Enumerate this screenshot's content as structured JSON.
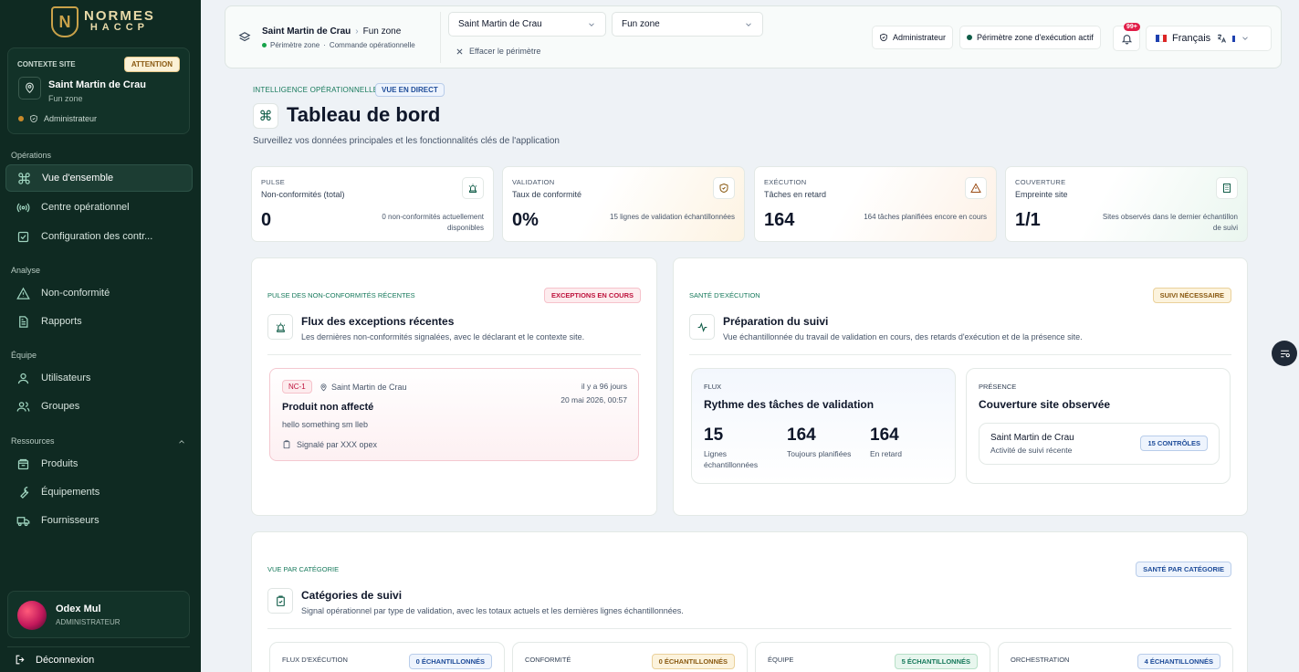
{
  "brand": {
    "line1": "NORMES",
    "line2": "HACCP",
    "mark": "N"
  },
  "site_context": {
    "label": "CONTEXTE SITE",
    "badge": "ATTENTION",
    "site": "Saint Martin de Crau",
    "zone": "Fun zone",
    "role": "Administrateur"
  },
  "sidebar": {
    "sections": [
      {
        "title": "Opérations",
        "items": [
          {
            "label": "Vue d'ensemble",
            "icon": "command-icon",
            "active": true
          },
          {
            "label": "Centre opérationnel",
            "icon": "broadcast-icon"
          },
          {
            "label": "Configuration des contr...",
            "icon": "checkbox-icon"
          }
        ]
      },
      {
        "title": "Analyse",
        "items": [
          {
            "label": "Non-conformité",
            "icon": "warning-triangle-icon"
          },
          {
            "label": "Rapports",
            "icon": "document-icon"
          }
        ]
      },
      {
        "title": "Équipe",
        "items": [
          {
            "label": "Utilisateurs",
            "icon": "user-icon"
          },
          {
            "label": "Groupes",
            "icon": "users-icon"
          }
        ]
      },
      {
        "title": "Ressources",
        "items": [
          {
            "label": "Produits",
            "icon": "package-icon"
          },
          {
            "label": "Équipements",
            "icon": "wrench-icon"
          },
          {
            "label": "Fournisseurs",
            "icon": "truck-icon"
          }
        ]
      }
    ],
    "user": {
      "name": "Odex Mul",
      "role": "ADMINISTRATEUR"
    },
    "logout": "Déconnexion"
  },
  "topbar": {
    "breadcrumb_site": "Saint Martin de Crau",
    "breadcrumb_zone": "Fun zone",
    "scope": "Périmètre zone",
    "scope_mode": "Commande opérationnelle",
    "site_select": "Saint Martin de Crau",
    "zone_select": "Fun zone",
    "clear": "Effacer le périmètre",
    "role": "Administrateur",
    "scope_status": "Périmètre zone d'exécution actif",
    "notifications": "99+",
    "language": "Français"
  },
  "header": {
    "eyebrow": "INTELLIGENCE OPÉRATIONNELLE",
    "live": "VUE EN DIRECT",
    "title": "Tableau de bord",
    "subtitle": "Surveillez vos données principales et les fonctionnalités clés de l'application"
  },
  "kpis": [
    {
      "label": "PULSE",
      "sub": "Non-conformités (total)",
      "value": "0",
      "note": "0 non-conformités actuellement disponibles",
      "icon": "siren-icon"
    },
    {
      "label": "VALIDATION",
      "sub": "Taux de conformité",
      "value": "0%",
      "note": "15 lignes de validation échantillonnées",
      "icon": "shield-check-icon"
    },
    {
      "label": "EXÉCUTION",
      "sub": "Tâches en retard",
      "value": "164",
      "note": "164 tâches planifiées encore en cours",
      "icon": "alert-triangle-icon"
    },
    {
      "label": "COUVERTURE",
      "sub": "Empreinte site",
      "value": "1/1",
      "note": "Sites observés dans le dernier échantillon de suivi",
      "icon": "building-icon"
    }
  ],
  "exceptions": {
    "eyebrow": "PULSE DES NON-CONFORMITÉS RÉCENTES",
    "tag": "EXCEPTIONS EN COURS",
    "title": "Flux des exceptions récentes",
    "desc": "Les dernières non-conformités signalées, avec le déclarant et le contexte site.",
    "item": {
      "id": "NC-1",
      "site": "Saint Martin de Crau",
      "ago": "il y a 96 jours",
      "date": "20 mai 2026, 00:57",
      "title": "Produit non affecté",
      "desc": "hello something sm lleb",
      "by": "Signalé par XXX opex"
    }
  },
  "health": {
    "eyebrow": "SANTÉ D'EXÉCUTION",
    "tag": "SUIVI NÉCESSAIRE",
    "title": "Préparation du suivi",
    "desc": "Vue échantillonnée du travail de validation en cours, des retards d'exécution et de la présence site.",
    "flux": {
      "eyebrow": "FLUX",
      "title": "Rythme des tâches de validation",
      "stats": [
        {
          "value": "15",
          "label": "Lignes échantillonnées"
        },
        {
          "value": "164",
          "label": "Toujours planifiées"
        },
        {
          "value": "164",
          "label": "En retard"
        }
      ]
    },
    "presence": {
      "eyebrow": "PRÉSENCE",
      "title": "Couverture site observée",
      "site": "Saint Martin de Crau",
      "desc": "Activité de suivi récente",
      "tag": "15 CONTRÔLES"
    }
  },
  "categories": {
    "eyebrow": "VUE PAR CATÉGORIE",
    "tag": "SANTÉ PAR CATÉGORIE",
    "title": "Catégories de suivi",
    "desc": "Signal opérationnel par type de validation, avec les totaux actuels et les dernières lignes échantillonnées.",
    "cards": [
      {
        "label": "FLUX D'EXÉCUTION",
        "tag": "0 ÉCHANTILLONNÉS",
        "tone": "blue"
      },
      {
        "label": "CONFORMITÉ",
        "tag": "0 ÉCHANTILLONNÉS",
        "tone": "amber"
      },
      {
        "label": "ÉQUIPE",
        "tag": "5 ÉCHANTILLONNÉS",
        "tone": "green"
      },
      {
        "label": "ORCHESTRATION",
        "tag": "4 ÉCHANTILLONNÉS",
        "tone": "blue"
      }
    ]
  },
  "colors": {
    "sidebar": "#0f2a22",
    "accent_gold": "#c9a24a",
    "brand_green": "#16795b",
    "danger": "#be123c"
  }
}
